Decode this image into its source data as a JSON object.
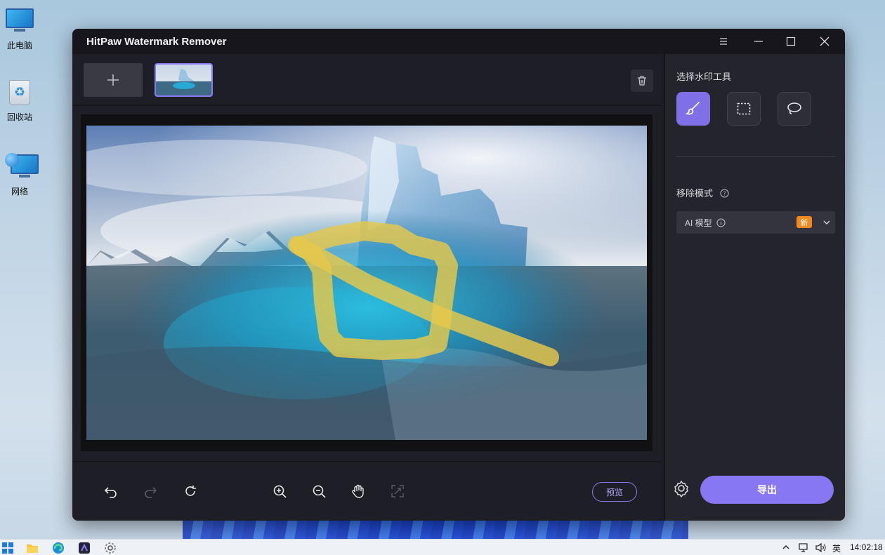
{
  "desktop": {
    "icons": [
      {
        "label": "此电脑"
      },
      {
        "label": "回收站"
      },
      {
        "label": "网络"
      }
    ]
  },
  "window": {
    "title": "HitPaw Watermark Remover"
  },
  "toolbar": {
    "add_icon": "plus-icon",
    "delete_icon": "trash-icon"
  },
  "bottom_tools": {
    "undo_icon": "undo-icon",
    "redo_icon": "redo-icon",
    "reset_icon": "refresh-icon",
    "zoom_in_icon": "zoom-in-icon",
    "zoom_out_icon": "zoom-out-icon",
    "pan_icon": "hand-icon",
    "fit_icon": "fit-screen-icon",
    "preview_label": "预览"
  },
  "sidebar": {
    "select_tool_label": "选择水印工具",
    "tools": [
      "brush-tool",
      "rectangle-select-tool",
      "lasso-tool"
    ],
    "active_tool": "brush-tool",
    "removal_mode_label": "移除模式",
    "mode_value": "AI 模型",
    "new_badge": "新",
    "export_label": "导出"
  },
  "taskbar": {
    "ime": "英",
    "time": "14:02:18"
  },
  "colors": {
    "accent": "#8777f2",
    "badge": "#f08a1e",
    "window_bg": "#1c1c24"
  }
}
